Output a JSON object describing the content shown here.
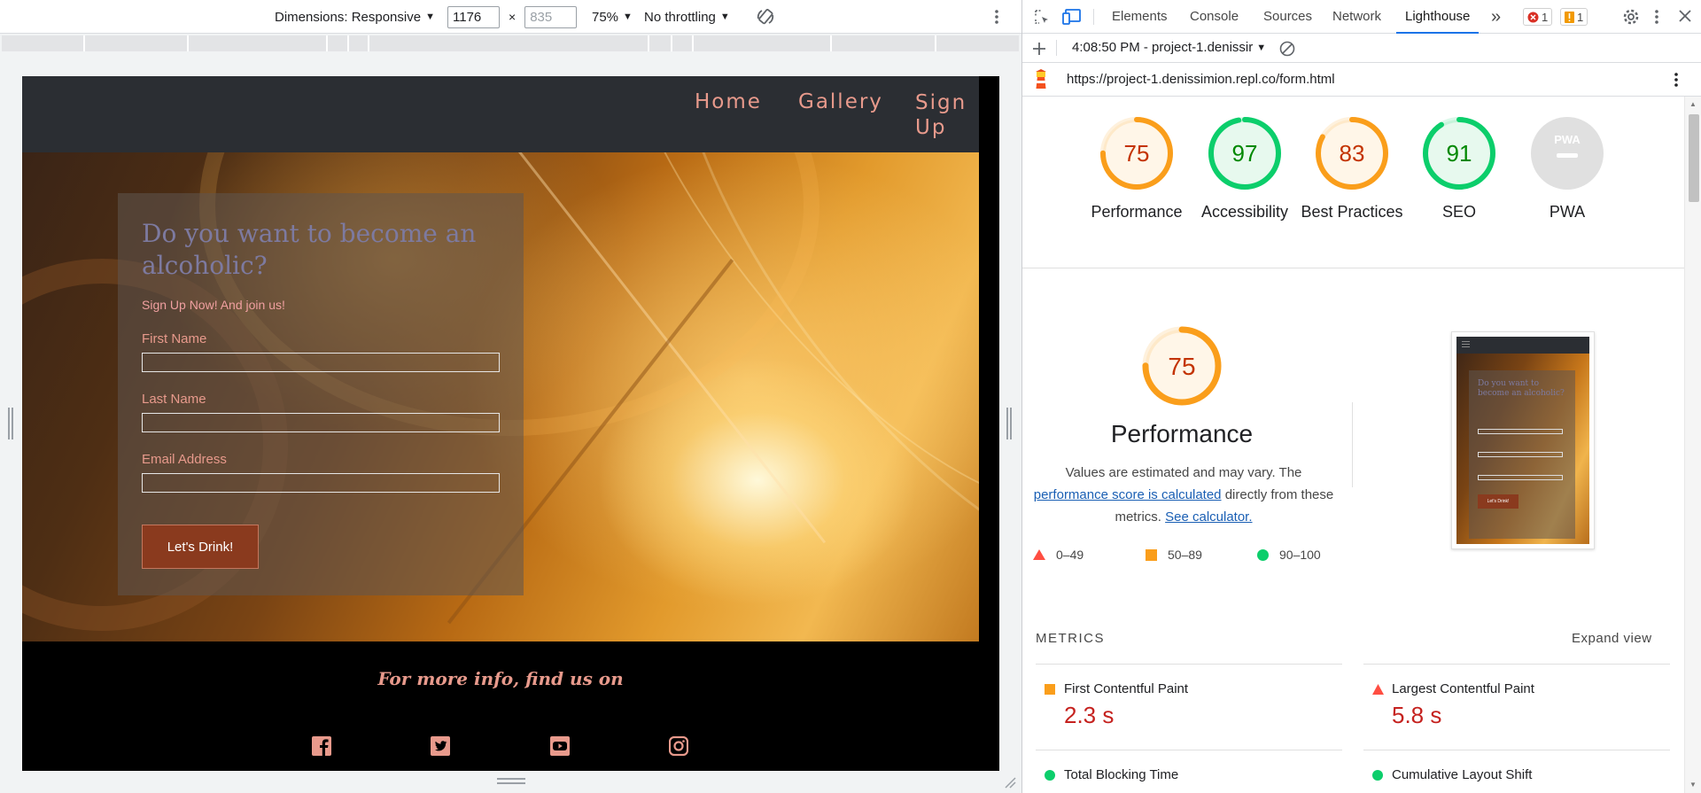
{
  "device_toolbar": {
    "dimensions_label": "Dimensions: Responsive",
    "width_value": "1176",
    "height_value": "835",
    "times": "×",
    "zoom": "75%",
    "throttling": "No throttling"
  },
  "site": {
    "nav": [
      "Home",
      "Gallery",
      "Sign Up"
    ],
    "form": {
      "title": "Do you want to become an alcoholic?",
      "subtitle": "Sign Up Now! And join us!",
      "fields": [
        "First Name",
        "Last Name",
        "Email Address"
      ],
      "submit": "Let's Drink!"
    },
    "footer": {
      "heading": "For more info, find us on",
      "social": [
        "facebook-icon",
        "twitter-icon",
        "youtube-icon",
        "instagram-icon"
      ]
    }
  },
  "devtools": {
    "tabs": [
      "Elements",
      "Console",
      "Sources",
      "Network",
      "Lighthouse"
    ],
    "active_tab": "Lighthouse",
    "more_tabs": "»",
    "error_count": "1",
    "warning_count": "1",
    "report_select": "4:08:50 PM - project-1.denissir",
    "url": "https://project-1.denissimion.repl.co/form.html"
  },
  "lighthouse": {
    "scores": [
      {
        "label": "Performance",
        "score": "75",
        "status": "average"
      },
      {
        "label": "Accessibility",
        "score": "97",
        "status": "pass"
      },
      {
        "label": "Best Practices",
        "score": "83",
        "status": "average"
      },
      {
        "label": "SEO",
        "score": "91",
        "status": "pass"
      },
      {
        "label": "PWA",
        "score": "",
        "status": "na"
      }
    ],
    "pwa_badge_text": "PWA",
    "performance": {
      "score": "75",
      "title": "Performance",
      "desc_1": "Values are estimated and may vary. The",
      "desc_link": "performance score is calculated",
      "desc_2": "directly from these metrics.",
      "calculator_link": "See calculator."
    },
    "legend": [
      "0–49",
      "50–89",
      "90–100"
    ],
    "metrics_label": "METRICS",
    "expand_view": "Expand view",
    "metrics": [
      {
        "name": "First Contentful Paint",
        "value": "2.3 s",
        "status": "average"
      },
      {
        "name": "Largest Contentful Paint",
        "value": "5.8 s",
        "status": "fail"
      },
      {
        "name": "Total Blocking Time",
        "value": "",
        "status": "pass"
      },
      {
        "name": "Cumulative Layout Shift",
        "value": "",
        "status": "pass"
      }
    ],
    "thumb": {
      "title": "Do you want to become an alcoholic?",
      "button": "Let's Drink!"
    }
  },
  "colors": {
    "average": "#fa9e1b",
    "pass": "#0cce6b",
    "fail": "#ff4e42",
    "accent": "#1a73e8"
  }
}
